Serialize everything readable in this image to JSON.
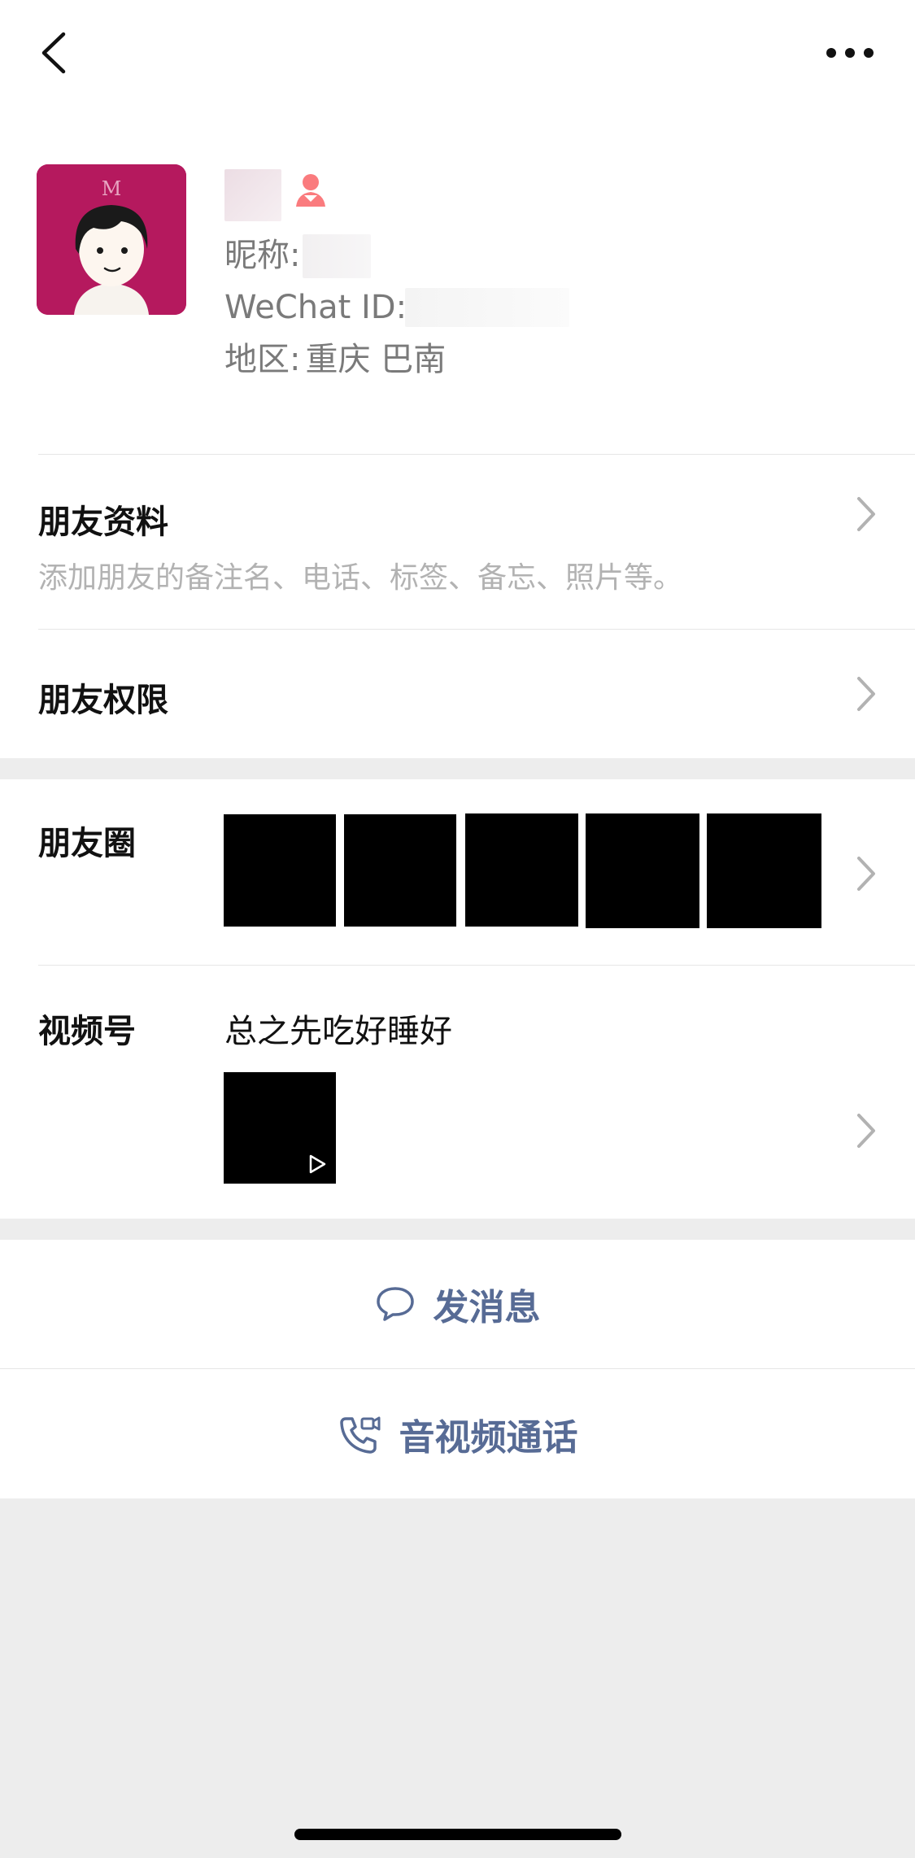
{
  "profile": {
    "nickname_label": "昵称:",
    "wechat_id_label": "WeChat ID:",
    "region_label": "地区:",
    "region_value": "重庆 巴南"
  },
  "rows": {
    "friend_info": {
      "title": "朋友资料",
      "subtitle": "添加朋友的备注名、电话、标签、备忘、照片等。"
    },
    "friend_permissions": {
      "title": "朋友权限"
    },
    "moments": {
      "title": "朋友圈"
    },
    "channels": {
      "title": "视频号",
      "channel_name": "总之先吃好睡好"
    }
  },
  "actions": {
    "send_message": "发消息",
    "video_call": "音视频通话"
  },
  "icons": {
    "back": "chevron-left-icon",
    "more": "ellipsis-icon",
    "gender": "female-icon",
    "message": "chat-bubble-icon",
    "call": "phone-video-icon",
    "play": "play-icon"
  },
  "colors": {
    "link_blue": "#576b95",
    "gender_pink": "#fa7b7e",
    "avatar_bg": "#b5195e"
  }
}
